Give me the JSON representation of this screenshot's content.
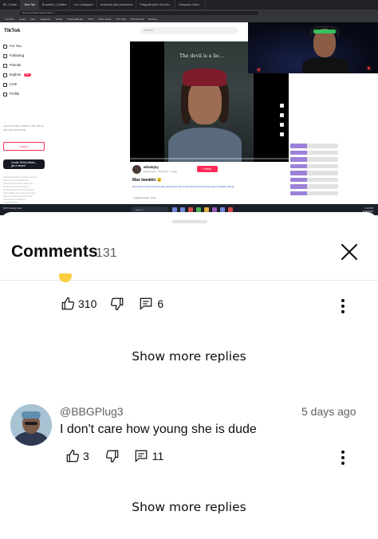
{
  "video": {
    "browser_tabs": [
      "BK | Twitch",
      "New Tab",
      "Bi-weekl's | Untitled",
      "Live | Instagram",
      "academic girls academies",
      "PlaygotBoyWor And Mo...",
      "Dalrymple Video..."
    ],
    "url": "tiktok.com/@whaiejsy/video/7...",
    "bookmarks": [
      "YouTube",
      "Gmail",
      "Uber",
      "Instagram",
      "Twitter",
      "PinterestBoard",
      "NFTs",
      "Distro Guide",
      "ITO Chat",
      "DCGold Opt",
      "Boolrlos"
    ],
    "tiktok": {
      "logo": "TikTok",
      "search_placeholder": "Search",
      "nav": [
        {
          "label": "For You",
          "icon": "home-icon"
        },
        {
          "label": "Following",
          "icon": "following-icon"
        },
        {
          "label": "Friends",
          "icon": "friends-icon"
        },
        {
          "label": "Explore",
          "icon": "compass-icon",
          "badge": "New"
        },
        {
          "label": "LIVE",
          "icon": "live-icon"
        },
        {
          "label": "Profile",
          "icon": "profile-icon"
        }
      ],
      "login_prompt": "Log in to follow creators, like videos, and view comments.",
      "login_button": "Log in",
      "effects_line1": "Create TikTok effects,",
      "effects_line2": "get a reward",
      "footer_lines": [
        "About  Newsroom  Contact  Careers",
        "TikTok for Good  Advertise",
        "TikTok LIVE Creator Networks",
        "Developers  Transparency",
        "TikTok Rewards  TikTok Browse",
        "Help  Safety  Terms  Privacy Policy",
        "Privacy Center  Creator Portal",
        "Community Guidelines",
        "© 2024 TikTok"
      ],
      "video_caption": "The devil is a lie...",
      "author": "whaiejsy",
      "author_sub": "jdobrigmafs · Whaiekin · 1d ago",
      "follow_button": "Follow",
      "video_title": "Max tweakin 😮",
      "hashtags": "#fyp #foryou #trend #foryourpage #funnyvideo #funny #trending #viral #comedy #rap #relatable #family",
      "sound": "♫ original sound - Yorui"
    },
    "taskbar": {
      "weather": "18°C Mostly clear",
      "search_placeholder": "Search",
      "time": "1:16 PM",
      "date": "12/8/2023"
    }
  },
  "comments_sheet": {
    "title": "Comments",
    "count": "131",
    "reply_actions": {
      "likes": "310",
      "replies": "6"
    },
    "show_more_1": "Show more replies",
    "comment": {
      "handle": "@BBGPlug3",
      "time": "5 days ago",
      "text": "I don't care how young she is dude",
      "likes": "3",
      "replies": "11"
    },
    "show_more_2": "Show more replies"
  },
  "colors": {
    "text": "#0f0f0f",
    "secondary_text": "#606060",
    "divider": "#e5e5e5",
    "tiktok_red": "#fe2c55"
  }
}
